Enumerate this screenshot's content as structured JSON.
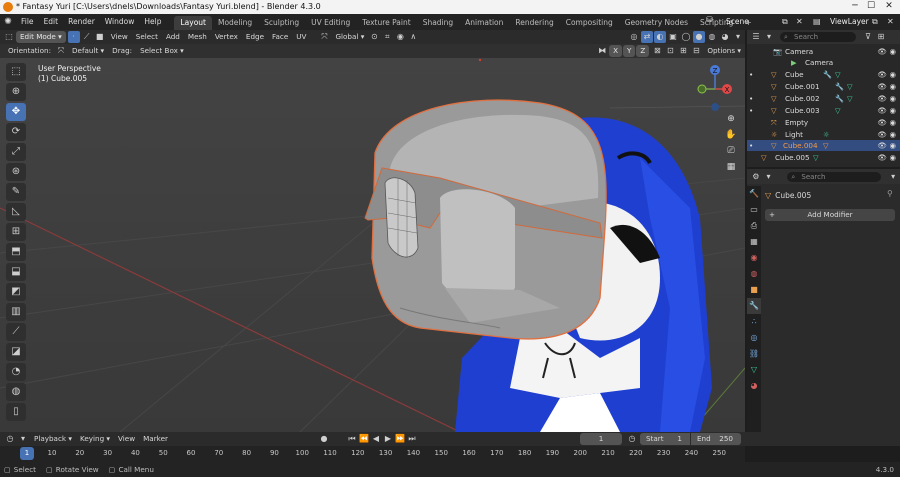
{
  "window": {
    "title": "* Fantasy Yuri [C:\\Users\\dnels\\Downloads\\Fantasy Yuri.blend] - Blender 4.3.0"
  },
  "menus": [
    "File",
    "Edit",
    "Render",
    "Window",
    "Help"
  ],
  "workspaces": [
    "Layout",
    "Modeling",
    "Sculpting",
    "UV Editing",
    "Texture Paint",
    "Shading",
    "Animation",
    "Rendering",
    "Compositing",
    "Geometry Nodes",
    "Scripting"
  ],
  "scene": "Scene",
  "view_layer": "ViewLayer",
  "header": {
    "mode": "Edit Mode",
    "view_menus": [
      "View",
      "Select",
      "Add",
      "Mesh",
      "Vertex",
      "Edge",
      "Face",
      "UV"
    ],
    "transform": "Global"
  },
  "header2": {
    "orientation_label": "Orientation:",
    "orientation_value": "Default",
    "drag_label": "Drag:",
    "drag_value": "Select Box",
    "options": "Options",
    "axes": [
      "X",
      "Y",
      "Z"
    ]
  },
  "viewport": {
    "perspective": "User Perspective",
    "object": "(1) Cube.005"
  },
  "gizmo": {
    "x": "X",
    "y": "Y",
    "z": "Z"
  },
  "outliner": {
    "search_placeholder": "Search",
    "items": [
      {
        "name": "Camera",
        "child": "Camera"
      },
      {
        "name": "Cube"
      },
      {
        "name": "Cube.001"
      },
      {
        "name": "Cube.002"
      },
      {
        "name": "Cube.003"
      },
      {
        "name": "Empty"
      },
      {
        "name": "Light"
      },
      {
        "name": "Cube.004"
      },
      {
        "name": "Cube.005"
      }
    ]
  },
  "properties": {
    "search_placeholder": "Search",
    "object": "Cube.005",
    "add_modifier": "Add Modifier"
  },
  "timeline": {
    "menus": [
      "Playback",
      "Keying",
      "View",
      "Marker"
    ],
    "current_frame": "1",
    "start_label": "Start",
    "start": "1",
    "end_label": "End",
    "end": "250",
    "ticks": [
      "1",
      "10",
      "20",
      "30",
      "40",
      "50",
      "60",
      "70",
      "80",
      "90",
      "100",
      "110",
      "120",
      "130",
      "140",
      "150",
      "160",
      "170",
      "180",
      "190",
      "200",
      "210",
      "220",
      "230",
      "240",
      "250"
    ]
  },
  "status": {
    "select": "Select",
    "rotate": "Rotate View",
    "menu": "Call Menu",
    "version": "4.3.0"
  }
}
